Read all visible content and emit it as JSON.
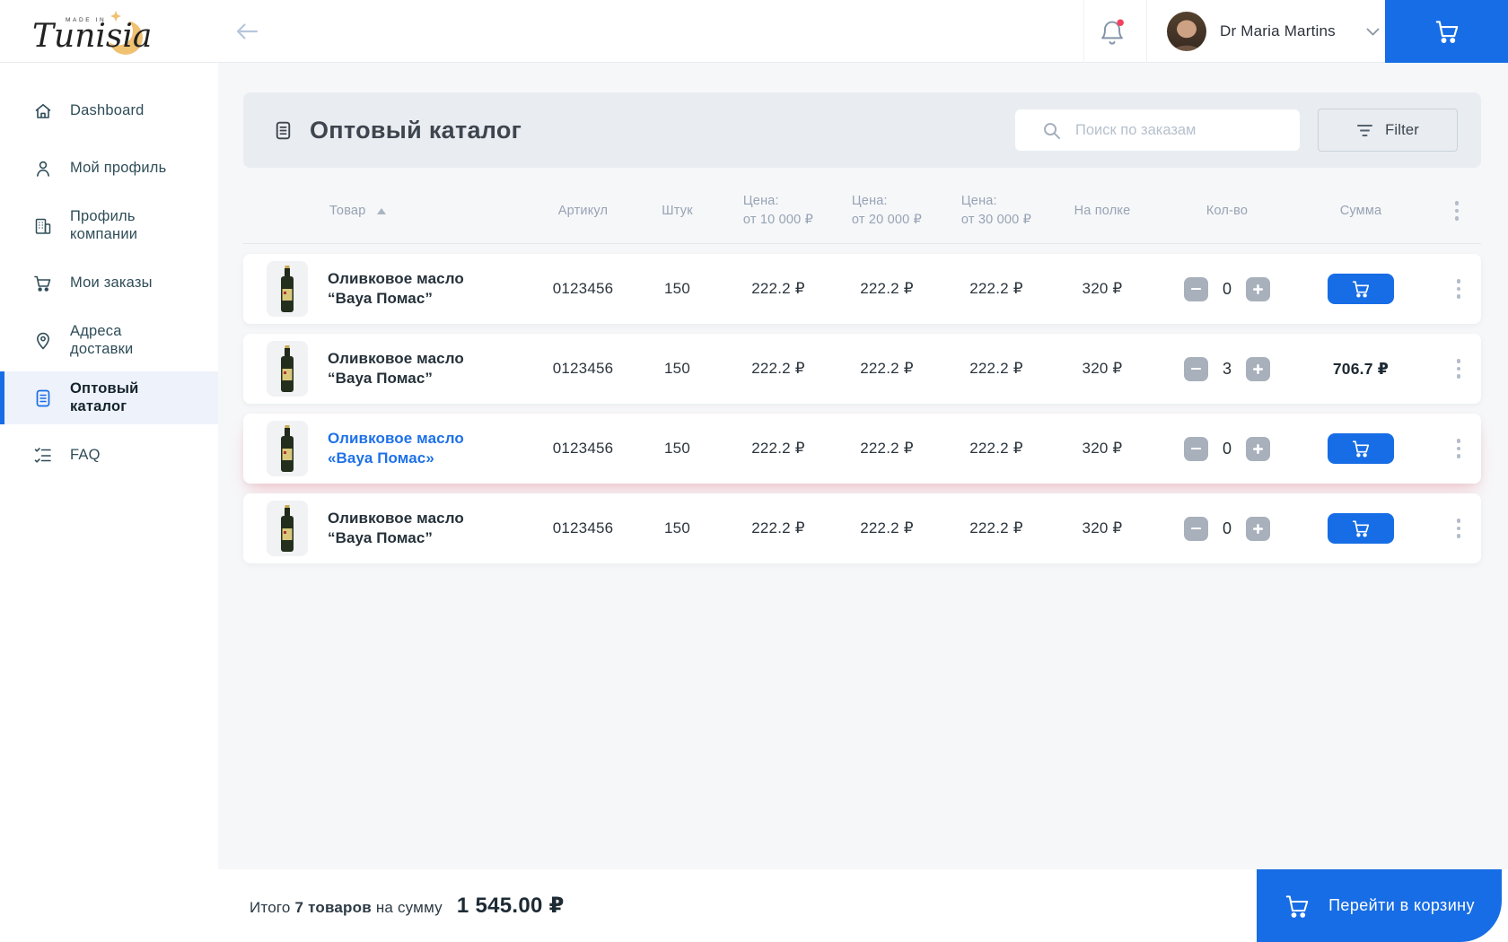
{
  "brand": {
    "made_in": "MADE IN",
    "name": "Tunisia"
  },
  "topbar": {
    "user_name": "Dr Maria Martins"
  },
  "sidebar": {
    "items": [
      {
        "label": "Dashboard",
        "icon": "home"
      },
      {
        "label": "Мой профиль",
        "icon": "user"
      },
      {
        "label": "Профиль компании",
        "icon": "company-building"
      },
      {
        "label": "Мои заказы",
        "icon": "orders-cart"
      },
      {
        "label": "Адреса доставки",
        "icon": "location-pin"
      },
      {
        "label": "Оптовый каталог",
        "icon": "catalog-document",
        "active": true
      },
      {
        "label": "FAQ",
        "icon": "faq-checklist"
      }
    ]
  },
  "page": {
    "title": "Оптовый каталог",
    "search_placeholder": "Поиск по заказам",
    "filter_label": "Filter"
  },
  "table": {
    "headers": {
      "product": "Товар",
      "sku": "Артикул",
      "units": "Штук",
      "price1_label": "Цена:",
      "price1_sub": "от 10 000 ₽",
      "price2_label": "Цена:",
      "price2_sub": "от 20 000 ₽",
      "price3_label": "Цена:",
      "price3_sub": "от 30 000 ₽",
      "shelf": "На полке",
      "qty": "Кол-во",
      "sum": "Сумма"
    },
    "rows": [
      {
        "title_line1": "Оливковое масло",
        "title_line2": "“Вауа Помас”",
        "sku": "0123456",
        "units": "150",
        "price1": "222.2 ₽",
        "price2": "222.2 ₽",
        "price3": "222.2 ₽",
        "shelf": "320 ₽",
        "qty": "0",
        "sum": ""
      },
      {
        "title_line1": "Оливковое масло",
        "title_line2": "“Вауа Помас”",
        "sku": "0123456",
        "units": "150",
        "price1": "222.2 ₽",
        "price2": "222.2 ₽",
        "price3": "222.2 ₽",
        "shelf": "320 ₽",
        "qty": "3",
        "sum": "706.7 ₽"
      },
      {
        "title_line1": "Оливковое масло",
        "title_line2": "«Вауа Помас»",
        "sku": "0123456",
        "units": "150",
        "price1": "222.2 ₽",
        "price2": "222.2 ₽",
        "price3": "222.2 ₽",
        "shelf": "320 ₽",
        "qty": "0",
        "sum": ""
      },
      {
        "title_line1": "Оливковое масло",
        "title_line2": "“Вауа Помас”",
        "sku": "0123456",
        "units": "150",
        "price1": "222.2 ₽",
        "price2": "222.2 ₽",
        "price3": "222.2 ₽",
        "shelf": "320 ₽",
        "qty": "0",
        "sum": ""
      }
    ]
  },
  "footer": {
    "total_label": "Итого",
    "total_count": "7 товаров",
    "total_infix": "на сумму",
    "total_sum": "1 545.00 ₽",
    "cart_button_label": "Перейти в  корзину"
  },
  "colors": {
    "accent_blue": "#176de5",
    "notification_red": "#f4415f",
    "logo_gold": "#efc171"
  }
}
